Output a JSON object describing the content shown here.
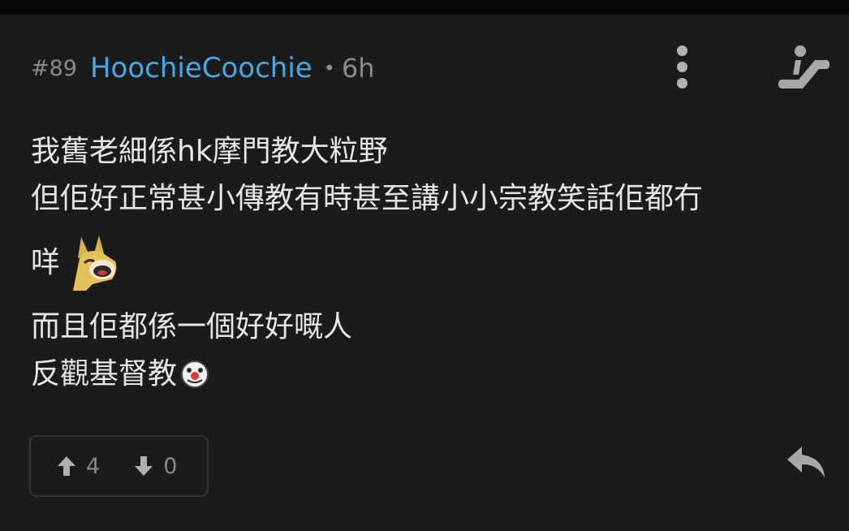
{
  "post": {
    "number": "#89",
    "username": "HoochieCoochie",
    "separator": "•",
    "time": "6h"
  },
  "content": {
    "lines": [
      "我舊老細係hk摩門教大粒野",
      "但佢好正常甚小傳教有時甚至講小小宗教笑話佢都冇",
      "咩",
      "而且佢都係一個好好嘅人",
      "反觀基督教"
    ],
    "emojis": [
      "yellow-dog-laugh-emoji",
      "clown-face-emoji"
    ]
  },
  "votes": {
    "up": "4",
    "down": "0"
  },
  "icons": {
    "more": "more-vertical-icon",
    "escalator": "escalator-icon",
    "reply": "reply-icon",
    "upvote": "arrow-up-icon",
    "downvote": "arrow-down-icon"
  },
  "colors": {
    "background": "#1b1b1b",
    "username": "#4aa8e0",
    "muted": "#8a8a8a",
    "text": "#e6e6e6"
  }
}
